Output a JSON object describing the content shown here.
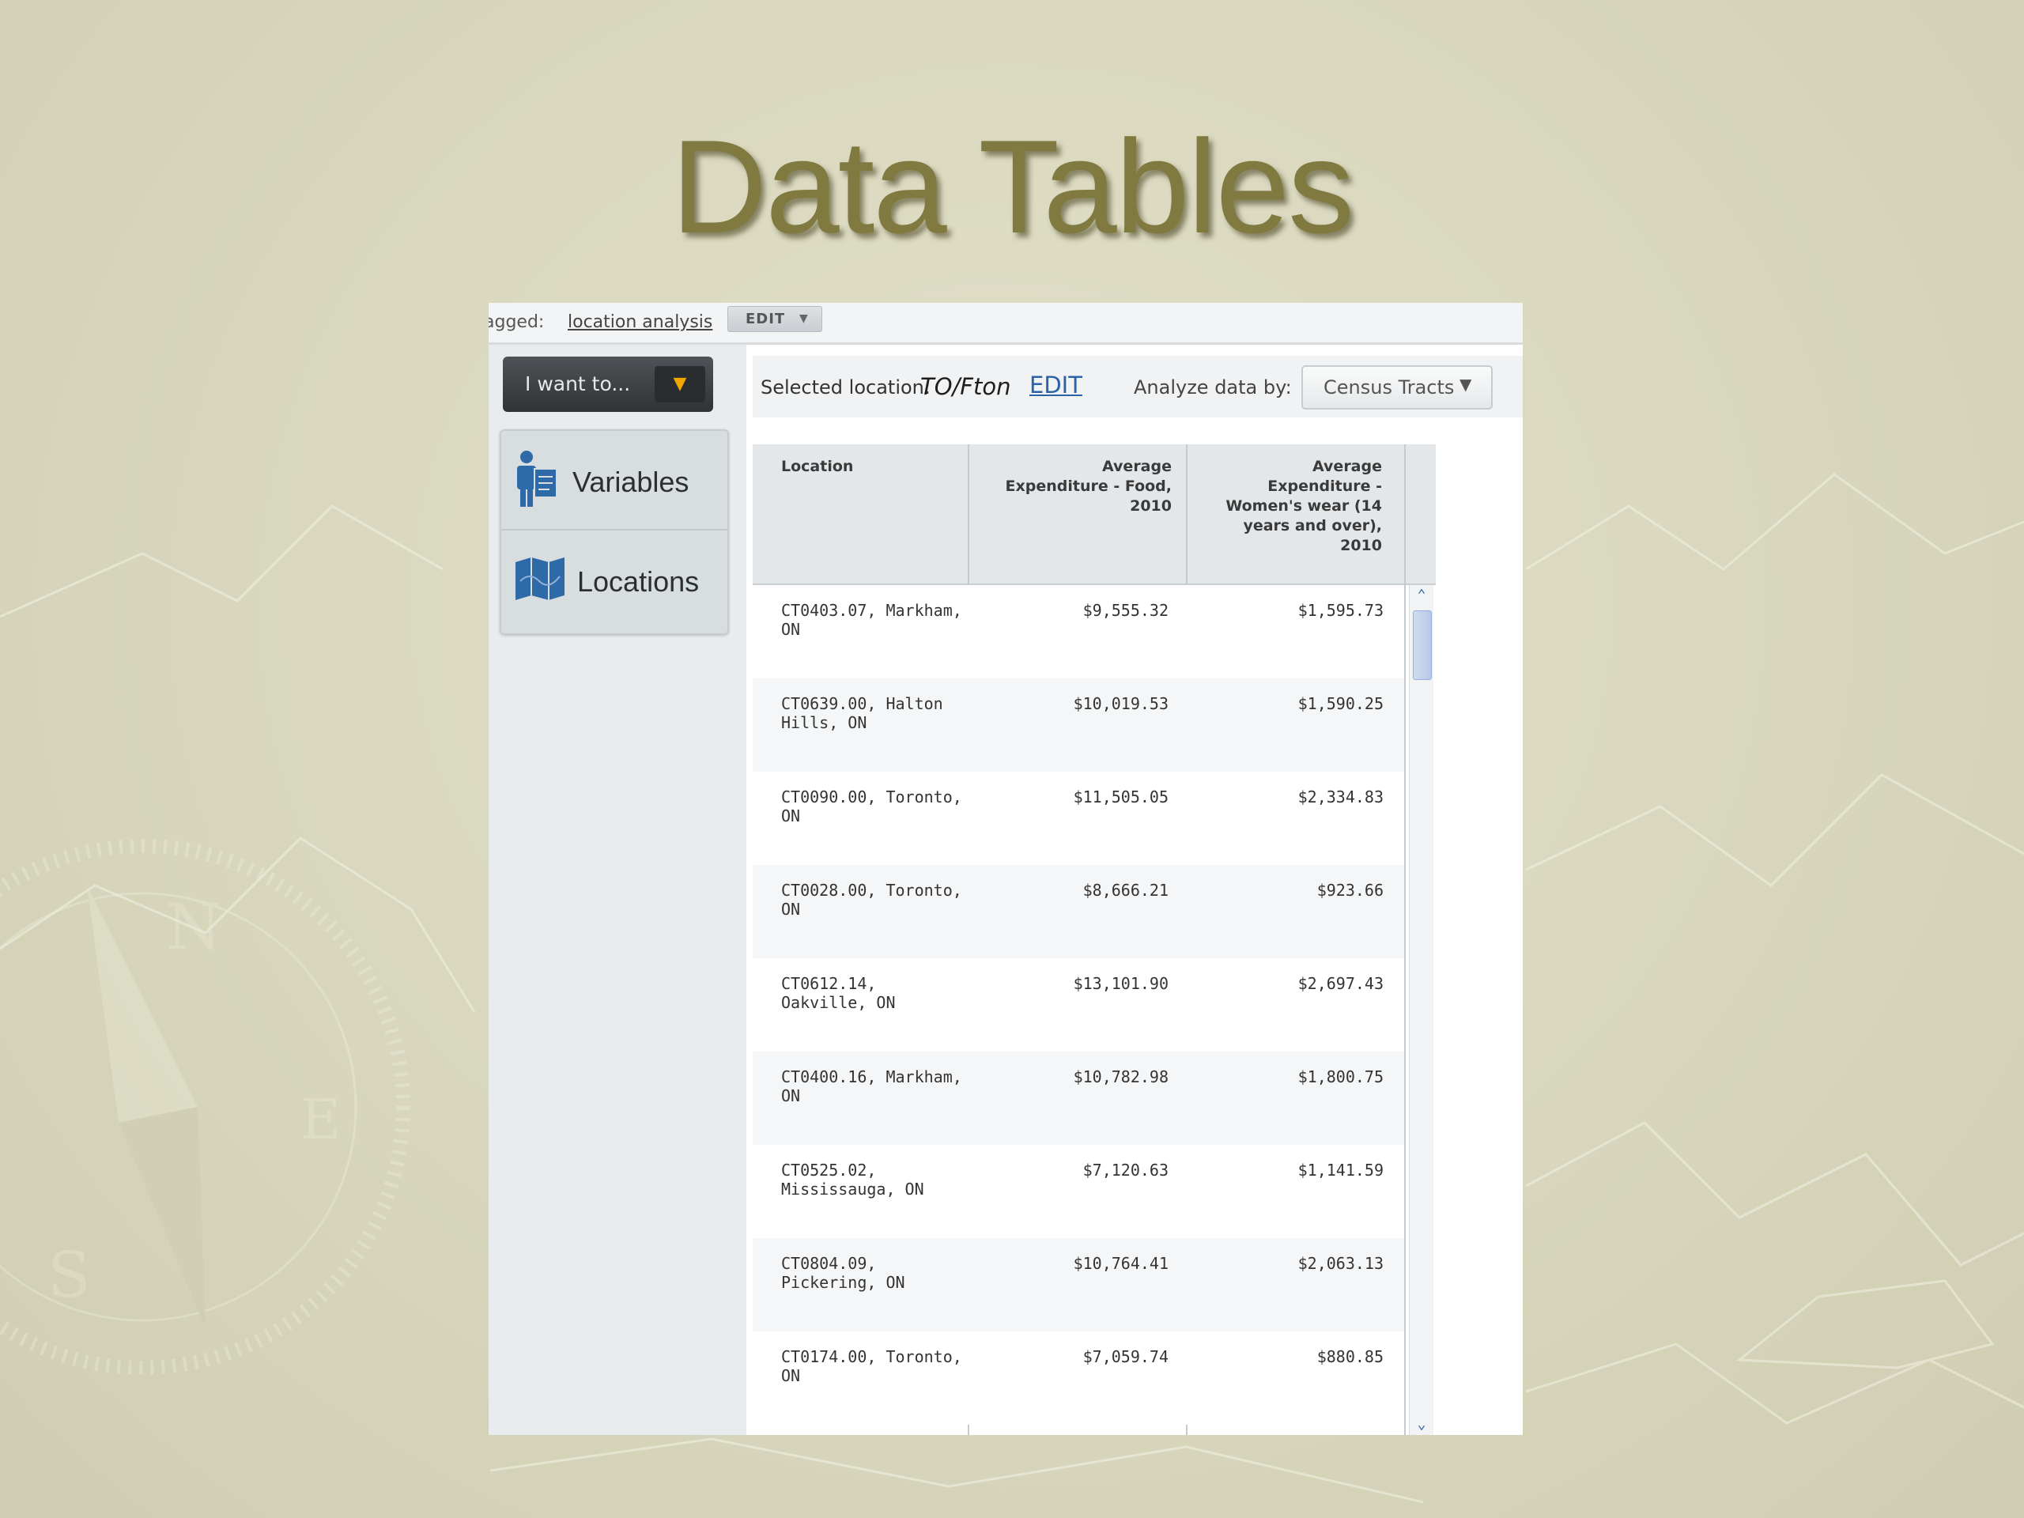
{
  "slide": {
    "title": "Data Tables"
  },
  "tagbar": {
    "label": "agged:",
    "link": "location analysis",
    "edit": "EDIT",
    "edit_caret": "▼"
  },
  "left": {
    "iwant_label": "I want to...",
    "iwant_caret": "▼",
    "nav": [
      {
        "label": "Variables",
        "icon": "person-document-icon"
      },
      {
        "label": "Locations",
        "icon": "map-icon"
      }
    ]
  },
  "selection": {
    "label": "Selected location:",
    "value": "TO/Fton",
    "edit": "EDIT",
    "analyze_label": "Analyze data by:",
    "analyze_value": "Census Tracts",
    "analyze_caret": "▼"
  },
  "table": {
    "headers": [
      "Location",
      "Average\nExpenditure - Food,\n2010",
      "Average\nExpenditure -\nWomen's wear (14\nyears and over),\n2010"
    ],
    "rows": [
      {
        "location": "CT0403.07, Markham, ON",
        "food": "$9,555.32",
        "women": "$1,595.73"
      },
      {
        "location": "CT0639.00, Halton Hills, ON",
        "food": "$10,019.53",
        "women": "$1,590.25"
      },
      {
        "location": "CT0090.00, Toronto, ON",
        "food": "$11,505.05",
        "women": "$2,334.83"
      },
      {
        "location": "CT0028.00, Toronto, ON",
        "food": "$8,666.21",
        "women": "$923.66"
      },
      {
        "location": "CT0612.14, Oakville, ON",
        "food": "$13,101.90",
        "women": "$2,697.43"
      },
      {
        "location": "CT0400.16, Markham, ON",
        "food": "$10,782.98",
        "women": "$1,800.75"
      },
      {
        "location": "CT0525.02, Mississauga, ON",
        "food": "$7,120.63",
        "women": "$1,141.59"
      },
      {
        "location": "CT0804.09, Pickering, ON",
        "food": "$10,764.41",
        "women": "$2,063.13"
      },
      {
        "location": "CT0174.00, Toronto, ON",
        "food": "$7,059.74",
        "women": "$880.85"
      }
    ]
  },
  "scrollbar": {
    "up": "⌃",
    "down": "⌄",
    "position_fraction": 0.0
  }
}
